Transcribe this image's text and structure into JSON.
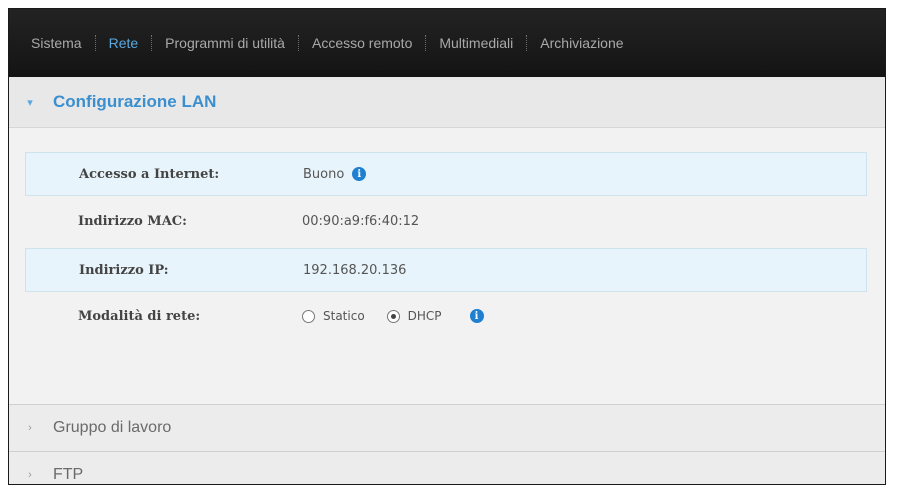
{
  "nav": {
    "items": [
      {
        "label": "Sistema",
        "active": false
      },
      {
        "label": "Rete",
        "active": true
      },
      {
        "label": "Programmi di utilità",
        "active": false
      },
      {
        "label": "Accesso remoto",
        "active": false
      },
      {
        "label": "Multimediali",
        "active": false
      },
      {
        "label": "Archiviazione",
        "active": false
      }
    ]
  },
  "lan": {
    "title": "Configurazione LAN",
    "chevron": "▾",
    "rows": {
      "internet": {
        "label": "Accesso a Internet:",
        "value": "Buono"
      },
      "mac": {
        "label": "Indirizzo MAC:",
        "value": "00:90:a9:f6:40:12"
      },
      "ip": {
        "label": "Indirizzo IP:",
        "value": "192.168.20.136"
      },
      "mode": {
        "label": "Modalità di rete:",
        "options": [
          {
            "label": "Statico",
            "selected": false
          },
          {
            "label": "DHCP",
            "selected": true
          }
        ]
      }
    },
    "info_glyph": "i"
  },
  "workgroup": {
    "title": "Gruppo di lavoro",
    "chevron": "›"
  },
  "ftp": {
    "title": "FTP",
    "chevron": "›"
  },
  "colors": {
    "accent": "#3b8fcf",
    "info": "#1f7fd1",
    "nav_bg": "#1a1a1a",
    "row_highlight": "#e8f4fb"
  }
}
